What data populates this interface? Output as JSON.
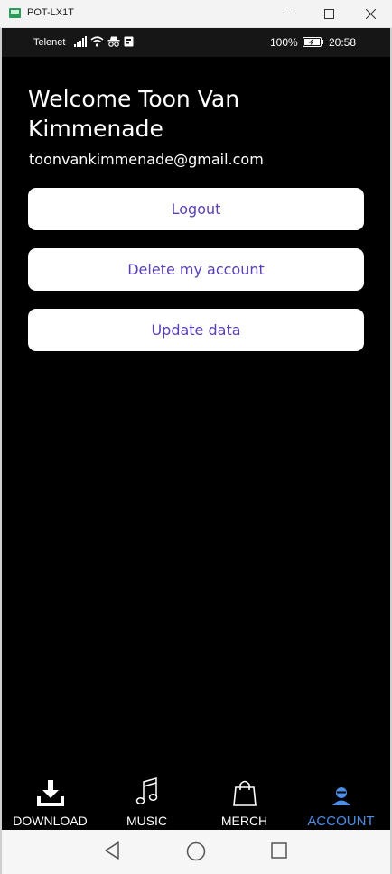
{
  "window": {
    "title": "POT-LX1T",
    "minimize_icon": "minimize-icon",
    "maximize_icon": "maximize-icon",
    "close_icon": "close-icon"
  },
  "status_bar": {
    "carrier": "Telenet",
    "battery_percent": "100%",
    "time": "20:58",
    "icons": [
      "signal-icon",
      "wifi-icon",
      "incognito-icon",
      "notification-icon",
      "battery-icon"
    ]
  },
  "account": {
    "welcome": "Welcome Toon Van Kimmenade",
    "email": "toonvankimmenade@gmail.com",
    "logout_label": "Logout",
    "delete_label": "Delete my account",
    "update_label": "Update data",
    "button_text_color": "#5b3fb8"
  },
  "tabs": [
    {
      "label": "DOWNLOAD",
      "icon": "download-icon"
    },
    {
      "label": "MUSIC",
      "icon": "music-note-icon"
    },
    {
      "label": "MERCH",
      "icon": "shopping-bag-icon"
    },
    {
      "label": "ACCOUNT",
      "icon": "user-icon",
      "active": true
    }
  ],
  "colors": {
    "background": "#000000",
    "active_tab": "#4a8ee8",
    "inactive_tab": "#ffffff"
  },
  "nav_bar": {
    "icons": [
      "back-icon",
      "home-icon",
      "recent-apps-icon"
    ]
  }
}
